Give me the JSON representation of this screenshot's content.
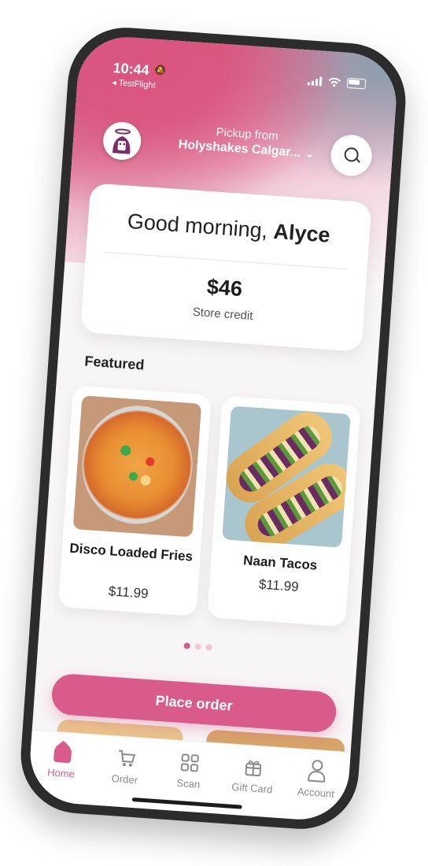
{
  "status_bar": {
    "time": "10:44",
    "back_app": "◂ TestFlight"
  },
  "header": {
    "pickup_label": "Pickup from",
    "store_name": "Holyshakes Calgar..."
  },
  "greeting_card": {
    "greeting_prefix": "Good morning, ",
    "user_name": "Alyce",
    "credit_amount": "$46",
    "credit_label": "Store credit"
  },
  "featured": {
    "title": "Featured",
    "items": [
      {
        "name": "Disco Loaded Fries",
        "price": "$11.99"
      },
      {
        "name": "Naan Tacos",
        "price": "$11.99"
      }
    ],
    "carousel": {
      "total": 3,
      "active_index": 0
    }
  },
  "place_order_button": "Place order",
  "tabs": [
    {
      "label": "Home",
      "icon": "home-icon",
      "active": true
    },
    {
      "label": "Order",
      "icon": "cart-icon",
      "active": false
    },
    {
      "label": "Scan",
      "icon": "qr-scan-icon",
      "active": false
    },
    {
      "label": "Gift Card",
      "icon": "gift-card-icon",
      "active": false
    },
    {
      "label": "Account",
      "icon": "account-icon",
      "active": false
    }
  ],
  "colors": {
    "accent": "#d95b8c",
    "frame": "#2c2c2c"
  }
}
